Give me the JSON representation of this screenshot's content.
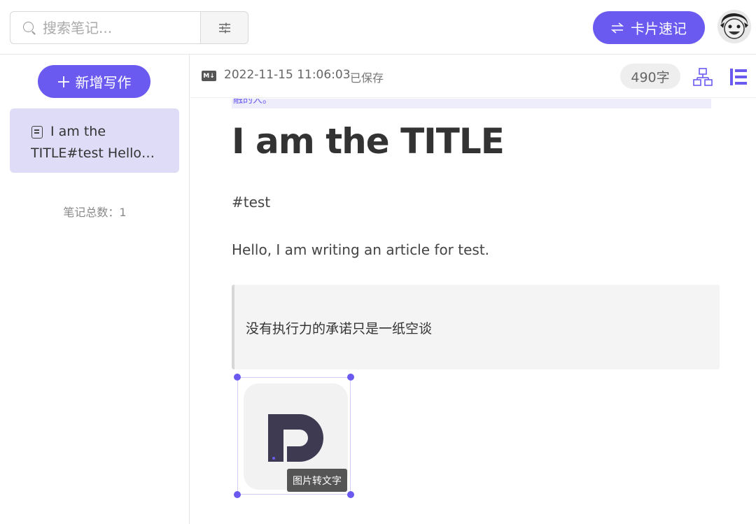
{
  "search": {
    "placeholder": "搜索笔记..."
  },
  "header": {
    "card_button_label": "卡片速记"
  },
  "sidebar": {
    "new_button_label": "新增写作",
    "notes": [
      {
        "line1": "I am the",
        "line2": "TITLE#test Hello…"
      }
    ],
    "note_count": "笔记总数：1"
  },
  "editor_header": {
    "format_badge": "M↓",
    "timestamp": "2022-11-15 11:06:03",
    "save_status": "已保存",
    "word_count": "490字"
  },
  "document": {
    "prev_fragment": "融的人。",
    "title": "I am the TITLE",
    "tag": "#test",
    "paragraph": "Hello, I am writing an article for test.",
    "quote": "没有执行力的承诺只是一纸空谈",
    "image_button": "图片转文字"
  },
  "colors": {
    "accent": "#6a5af0",
    "selected_note_bg": "#dedcf7",
    "quote_bg": "#f4f4f5"
  }
}
